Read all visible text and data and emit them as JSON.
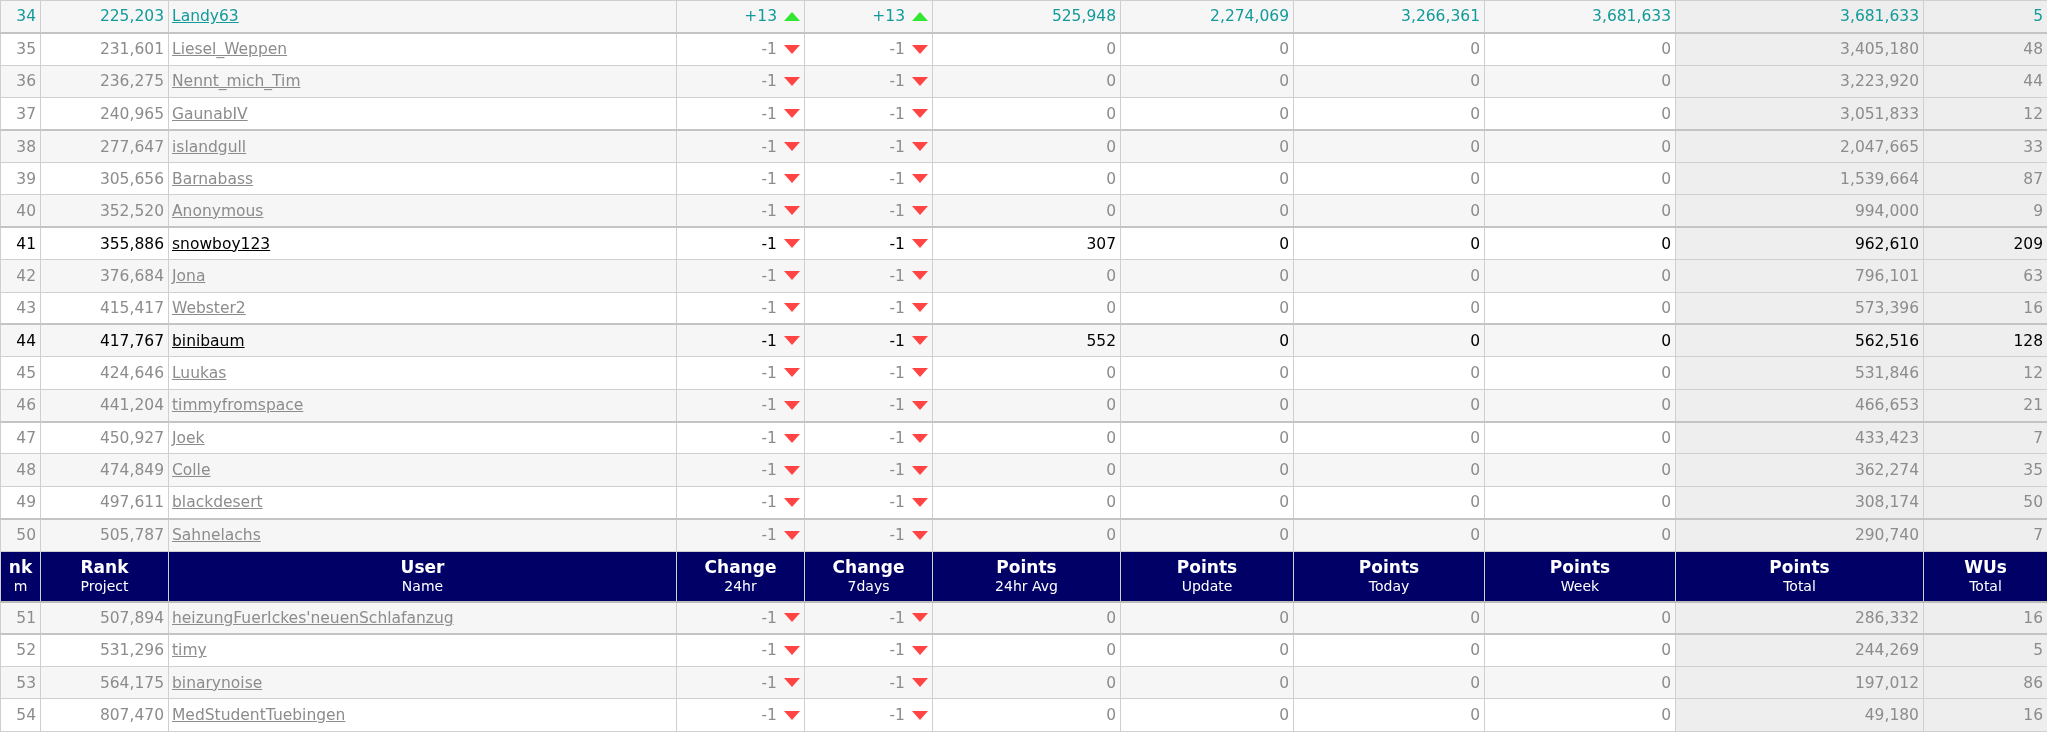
{
  "table": {
    "rows_top": [
      {
        "kind": "highlight",
        "rank_team": "34",
        "rank_project": "225,203",
        "user": "Landy63",
        "change_24hr": {
          "value": "+13",
          "up": true
        },
        "change_7days": {
          "value": "+13",
          "up": true
        },
        "points_24hr_avg": "525,948",
        "points_update": "2,274,069",
        "points_today": "3,266,361",
        "points_week": "3,681,633",
        "points_total": "3,681,633",
        "wus_total": "5"
      },
      {
        "kind": "inactive",
        "rank_team": "35",
        "rank_project": "231,601",
        "user": "Liesel_Weppen",
        "change_24hr": {
          "value": "-1",
          "up": false
        },
        "change_7days": {
          "value": "-1",
          "up": false
        },
        "points_24hr_avg": "0",
        "points_update": "0",
        "points_today": "0",
        "points_week": "0",
        "points_total": "3,405,180",
        "wus_total": "48"
      },
      {
        "kind": "inactive",
        "rank_team": "36",
        "rank_project": "236,275",
        "user": "Nennt_mich_Tim",
        "change_24hr": {
          "value": "-1",
          "up": false
        },
        "change_7days": {
          "value": "-1",
          "up": false
        },
        "points_24hr_avg": "0",
        "points_update": "0",
        "points_today": "0",
        "points_week": "0",
        "points_total": "3,223,920",
        "wus_total": "44"
      },
      {
        "kind": "inactive",
        "rank_team": "37",
        "rank_project": "240,965",
        "user": "GaunabIV",
        "change_24hr": {
          "value": "-1",
          "up": false
        },
        "change_7days": {
          "value": "-1",
          "up": false
        },
        "points_24hr_avg": "0",
        "points_update": "0",
        "points_today": "0",
        "points_week": "0",
        "points_total": "3,051,833",
        "wus_total": "12"
      },
      {
        "kind": "inactive",
        "rank_team": "38",
        "rank_project": "277,647",
        "user": "islandgull",
        "change_24hr": {
          "value": "-1",
          "up": false
        },
        "change_7days": {
          "value": "-1",
          "up": false
        },
        "points_24hr_avg": "0",
        "points_update": "0",
        "points_today": "0",
        "points_week": "0",
        "points_total": "2,047,665",
        "wus_total": "33"
      },
      {
        "kind": "inactive",
        "rank_team": "39",
        "rank_project": "305,656",
        "user": "Barnabass",
        "change_24hr": {
          "value": "-1",
          "up": false
        },
        "change_7days": {
          "value": "-1",
          "up": false
        },
        "points_24hr_avg": "0",
        "points_update": "0",
        "points_today": "0",
        "points_week": "0",
        "points_total": "1,539,664",
        "wus_total": "87"
      },
      {
        "kind": "inactive",
        "rank_team": "40",
        "rank_project": "352,520",
        "user": "Anonymous",
        "change_24hr": {
          "value": "-1",
          "up": false
        },
        "change_7days": {
          "value": "-1",
          "up": false
        },
        "points_24hr_avg": "0",
        "points_update": "0",
        "points_today": "0",
        "points_week": "0",
        "points_total": "994,000",
        "wus_total": "9"
      },
      {
        "kind": "active",
        "rank_team": "41",
        "rank_project": "355,886",
        "user": "snowboy123",
        "change_24hr": {
          "value": "-1",
          "up": false
        },
        "change_7days": {
          "value": "-1",
          "up": false
        },
        "points_24hr_avg": "307",
        "points_update": "0",
        "points_today": "0",
        "points_week": "0",
        "points_total": "962,610",
        "wus_total": "209"
      },
      {
        "kind": "inactive",
        "rank_team": "42",
        "rank_project": "376,684",
        "user": "Jona",
        "change_24hr": {
          "value": "-1",
          "up": false
        },
        "change_7days": {
          "value": "-1",
          "up": false
        },
        "points_24hr_avg": "0",
        "points_update": "0",
        "points_today": "0",
        "points_week": "0",
        "points_total": "796,101",
        "wus_total": "63"
      },
      {
        "kind": "inactive",
        "rank_team": "43",
        "rank_project": "415,417",
        "user": "Webster2",
        "change_24hr": {
          "value": "-1",
          "up": false
        },
        "change_7days": {
          "value": "-1",
          "up": false
        },
        "points_24hr_avg": "0",
        "points_update": "0",
        "points_today": "0",
        "points_week": "0",
        "points_total": "573,396",
        "wus_total": "16"
      },
      {
        "kind": "active",
        "rank_team": "44",
        "rank_project": "417,767",
        "user": "binibaum",
        "change_24hr": {
          "value": "-1",
          "up": false
        },
        "change_7days": {
          "value": "-1",
          "up": false
        },
        "points_24hr_avg": "552",
        "points_update": "0",
        "points_today": "0",
        "points_week": "0",
        "points_total": "562,516",
        "wus_total": "128"
      },
      {
        "kind": "inactive",
        "rank_team": "45",
        "rank_project": "424,646",
        "user": "Luukas",
        "change_24hr": {
          "value": "-1",
          "up": false
        },
        "change_7days": {
          "value": "-1",
          "up": false
        },
        "points_24hr_avg": "0",
        "points_update": "0",
        "points_today": "0",
        "points_week": "0",
        "points_total": "531,846",
        "wus_total": "12"
      },
      {
        "kind": "inactive",
        "rank_team": "46",
        "rank_project": "441,204",
        "user": "timmyfromspace",
        "change_24hr": {
          "value": "-1",
          "up": false
        },
        "change_7days": {
          "value": "-1",
          "up": false
        },
        "points_24hr_avg": "0",
        "points_update": "0",
        "points_today": "0",
        "points_week": "0",
        "points_total": "466,653",
        "wus_total": "21"
      },
      {
        "kind": "inactive",
        "rank_team": "47",
        "rank_project": "450,927",
        "user": "Joek",
        "change_24hr": {
          "value": "-1",
          "up": false
        },
        "change_7days": {
          "value": "-1",
          "up": false
        },
        "points_24hr_avg": "0",
        "points_update": "0",
        "points_today": "0",
        "points_week": "0",
        "points_total": "433,423",
        "wus_total": "7"
      },
      {
        "kind": "inactive",
        "rank_team": "48",
        "rank_project": "474,849",
        "user": "Colle",
        "change_24hr": {
          "value": "-1",
          "up": false
        },
        "change_7days": {
          "value": "-1",
          "up": false
        },
        "points_24hr_avg": "0",
        "points_update": "0",
        "points_today": "0",
        "points_week": "0",
        "points_total": "362,274",
        "wus_total": "35"
      },
      {
        "kind": "inactive",
        "rank_team": "49",
        "rank_project": "497,611",
        "user": "blackdesert",
        "change_24hr": {
          "value": "-1",
          "up": false
        },
        "change_7days": {
          "value": "-1",
          "up": false
        },
        "points_24hr_avg": "0",
        "points_update": "0",
        "points_today": "0",
        "points_week": "0",
        "points_total": "308,174",
        "wus_total": "50"
      },
      {
        "kind": "inactive",
        "rank_team": "50",
        "rank_project": "505,787",
        "user": "Sahnelachs",
        "change_24hr": {
          "value": "-1",
          "up": false
        },
        "change_7days": {
          "value": "-1",
          "up": false
        },
        "points_24hr_avg": "0",
        "points_update": "0",
        "points_today": "0",
        "points_week": "0",
        "points_total": "290,740",
        "wus_total": "7"
      }
    ],
    "columns": [
      {
        "title": "nk",
        "subtitle": "m"
      },
      {
        "title": "Rank",
        "subtitle": "Project"
      },
      {
        "title": "User",
        "subtitle": "Name"
      },
      {
        "title": "Change",
        "subtitle": "24hr"
      },
      {
        "title": "Change",
        "subtitle": "7days"
      },
      {
        "title": "Points",
        "subtitle": "24hr Avg"
      },
      {
        "title": "Points",
        "subtitle": "Update"
      },
      {
        "title": "Points",
        "subtitle": "Today"
      },
      {
        "title": "Points",
        "subtitle": "Week"
      },
      {
        "title": "Points",
        "subtitle": "Total"
      },
      {
        "title": "WUs",
        "subtitle": "Total"
      }
    ],
    "rows_bottom": [
      {
        "kind": "inactive",
        "rank_team": "51",
        "rank_project": "507,894",
        "user": "heizungFuerIckes'neuenSchlafanzug",
        "change_24hr": {
          "value": "-1",
          "up": false
        },
        "change_7days": {
          "value": "-1",
          "up": false
        },
        "points_24hr_avg": "0",
        "points_update": "0",
        "points_today": "0",
        "points_week": "0",
        "points_total": "286,332",
        "wus_total": "16"
      },
      {
        "kind": "inactive",
        "rank_team": "52",
        "rank_project": "531,296",
        "user": "timy",
        "change_24hr": {
          "value": "-1",
          "up": false
        },
        "change_7days": {
          "value": "-1",
          "up": false
        },
        "points_24hr_avg": "0",
        "points_update": "0",
        "points_today": "0",
        "points_week": "0",
        "points_total": "244,269",
        "wus_total": "5"
      },
      {
        "kind": "inactive",
        "rank_team": "53",
        "rank_project": "564,175",
        "user": "binarynoise",
        "change_24hr": {
          "value": "-1",
          "up": false
        },
        "change_7days": {
          "value": "-1",
          "up": false
        },
        "points_24hr_avg": "0",
        "points_update": "0",
        "points_today": "0",
        "points_week": "0",
        "points_total": "197,012",
        "wus_total": "86"
      },
      {
        "kind": "inactive",
        "rank_team": "54",
        "rank_project": "807,470",
        "user": "MedStudentTuebingen",
        "change_24hr": {
          "value": "-1",
          "up": false
        },
        "change_7days": {
          "value": "-1",
          "up": false
        },
        "points_24hr_avg": "0",
        "points_update": "0",
        "points_today": "0",
        "points_week": "0",
        "points_total": "49,180",
        "wus_total": "16"
      }
    ]
  }
}
